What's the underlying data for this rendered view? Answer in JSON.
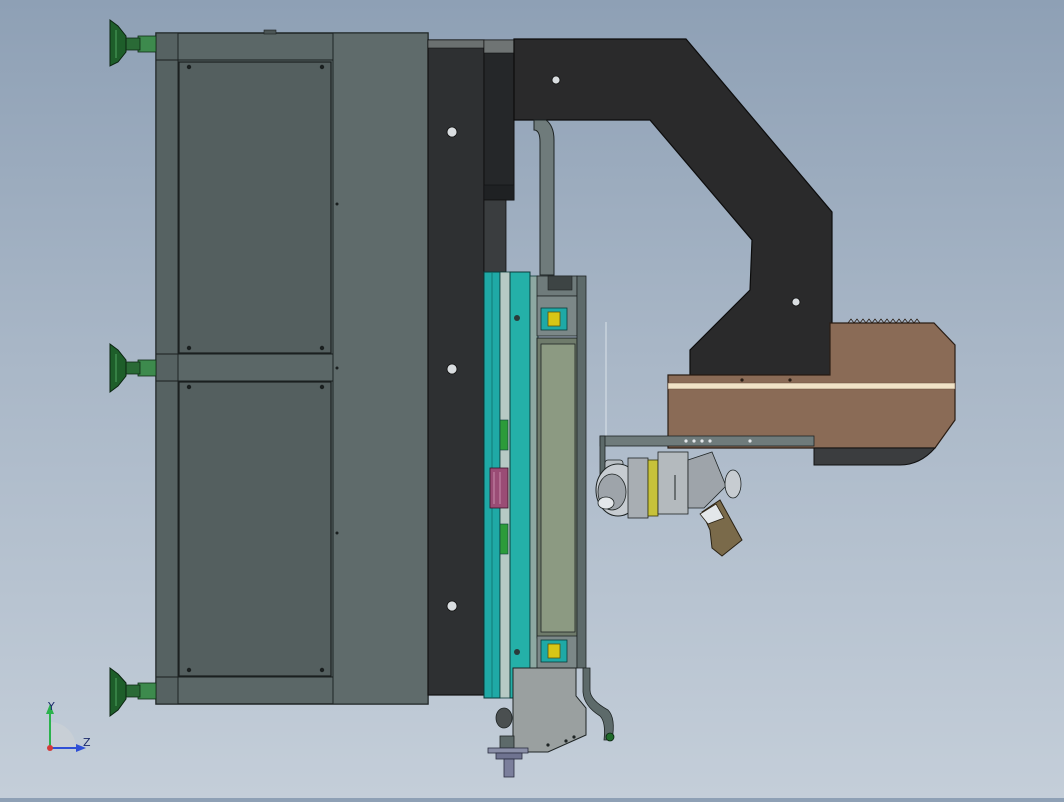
{
  "model": {
    "name": "",
    "colors": {
      "background_top": "#8ea0b5",
      "background_bottom": "#c4ced9",
      "frame_gray": "#5d6a6a",
      "dark_housing": "#2f3133",
      "arm_black": "#2b2b2b",
      "rail_teal": "#1fa9a6",
      "leveling_foot_green": "#1f6b2a",
      "tan_block": "#8a6b56",
      "stripe_cream": "#f0e2c6",
      "bearing_yellow": "#d7c616",
      "purple_block": "#9a4c75"
    }
  },
  "triad": {
    "y_label": "Y",
    "z_label": "Z",
    "y_color": "#2bb24c",
    "z_color": "#2f4fd6",
    "origin_color": "#d43a3a"
  }
}
